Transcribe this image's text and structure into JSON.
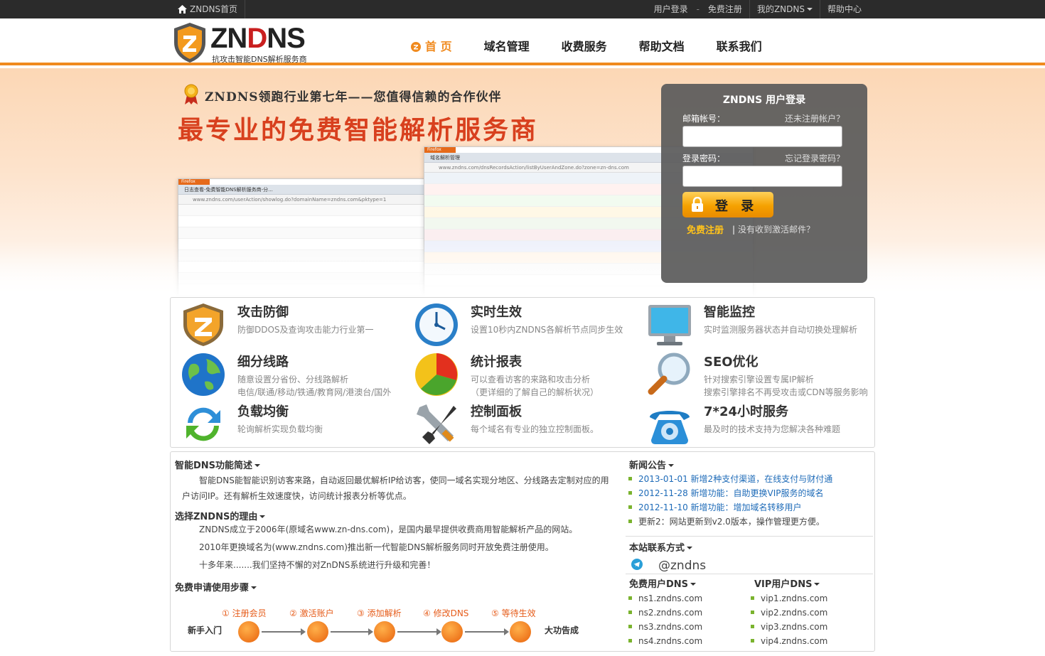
{
  "topbar": {
    "home": "ZNDNS首页",
    "login": "用户登录",
    "sep": "-",
    "register": "免费注册",
    "my": "我的ZNDNS",
    "help": "帮助中心"
  },
  "logo": {
    "brand_a": "ZN",
    "brand_b": "D",
    "brand_c": "NS",
    "slogan": "抗攻击智能DNS解析服务商"
  },
  "nav": [
    "首 页",
    "域名管理",
    "收费服务",
    "帮助文档",
    "联系我们"
  ],
  "banner": {
    "tagline": "ZNDNS领跑行业第七年——您值得信赖的合作伙伴",
    "headline": "最专业的免费智能解析服务商"
  },
  "login": {
    "title": "ZNDNS 用户登录",
    "email_label": "邮箱帐号：",
    "no_account": "还未注册帐户？",
    "password_label": "登录密码：",
    "forgot": "忘记登录密码？",
    "submit": "登 录",
    "register": "免费注册",
    "sep": "|",
    "no_email": "没有收到激活邮件？"
  },
  "features": [
    {
      "title": "攻击防御",
      "desc1": "防御DDOS及查询攻击能力行业第一",
      "desc2": "",
      "icon": "shield-icon"
    },
    {
      "title": "实时生效",
      "desc1": "设置10秒内ZNDNS各解析节点同步生效",
      "desc2": "",
      "icon": "clock-icon"
    },
    {
      "title": "智能监控",
      "desc1": "实时监测服务器状态并自动切换处理解析",
      "desc2": "",
      "icon": "monitor-icon"
    },
    {
      "title": "细分线路",
      "desc1": "随意设置分省份、分线路解析",
      "desc2": "电信/联通/移动/铁通/教育网/港澳台/国外",
      "icon": "globe-icon"
    },
    {
      "title": "统计报表",
      "desc1": "可以查看访客的来路和攻击分析",
      "desc2": "（更详细的了解自己的解析状况）",
      "icon": "pie-chart-icon"
    },
    {
      "title": "SEO优化",
      "desc1": "针对搜索引擎设置专属IP解析",
      "desc2": "搜索引擎排名不再受攻击或CDN等服务影响",
      "icon": "magnifier-icon"
    },
    {
      "title": "负载均衡",
      "desc1": "轮询解析实现负载均衡",
      "desc2": "",
      "icon": "refresh-icon"
    },
    {
      "title": "控制面板",
      "desc1": "每个域名有专业的独立控制面板。",
      "desc2": "",
      "icon": "tools-icon"
    },
    {
      "title": "7*24小时服务",
      "desc1": "最及时的技术支持为您解决各种难题",
      "desc2": "",
      "icon": "phone-icon"
    }
  ],
  "intro": {
    "title": "智能DNS功能简述",
    "text": "智能DNS能智能识别访客来路，自动返回最优解析IP给访客，使同一域名实现分地区、分线路去定制对应的用户访问IP。还有解析生效速度快，访问统计报表分析等优点。"
  },
  "reason": {
    "title": "选择ZNDNS的理由",
    "p1": "ZNDNS成立于2006年(原域名www.zn-dns.com)，是国内最早提供收费商用智能解析产品的网站。",
    "p2": "2010年更换域名为(www.zndns.com)推出新一代智能DNS解析服务同时开放免费注册使用。",
    "p3": "十多年来.......我们坚持不懈的对ZnDNS系统进行升级和完善！"
  },
  "steps": {
    "title": "免费申请使用步骤",
    "start": "新手入门",
    "end": "大功告成",
    "items": [
      "① 注册会员",
      "② 激活账户",
      "③ 添加解析",
      "④ 修改DNS",
      "⑤ 等待生效"
    ]
  },
  "news": {
    "title": "新闻公告",
    "items": [
      "2013-01-01 新增2种支付渠道，在线支付与财付通",
      "2012-11-28 新增功能：自助更换VIP服务的域名",
      "2012-11-10 新增功能：增加域名转移用户",
      "更新2：网站更新到v2.0版本，操作管理更方便。"
    ]
  },
  "contact": {
    "title": "本站联系方式",
    "handle": "@zndns"
  },
  "free_dns": {
    "title": "免费用户DNS",
    "items": [
      "ns1.zndns.com",
      "ns2.zndns.com",
      "ns3.zndns.com",
      "ns4.zndns.com"
    ]
  },
  "vip_dns": {
    "title": "VIP用户DNS",
    "items": [
      "vip1.zndns.com",
      "vip2.zndns.com",
      "vip3.zndns.com",
      "vip4.zndns.com"
    ]
  },
  "shots": {
    "left_tab": "日志查看-免费智能DNS解析服务商-分...",
    "left_url": "www.zndns.com/userAction/showlog.do?domainName=zndns.com&pktype=1",
    "right_tab": "域名解析管理",
    "right_url": "www.zndns.com/dnsRecordsAction/listByUserAndZone.do?zone=zn-dns.com",
    "ff": "Firefox"
  },
  "colors": {
    "accent": "#f08a1e",
    "headline": "#d8401e",
    "link": "#1e6bb8"
  }
}
